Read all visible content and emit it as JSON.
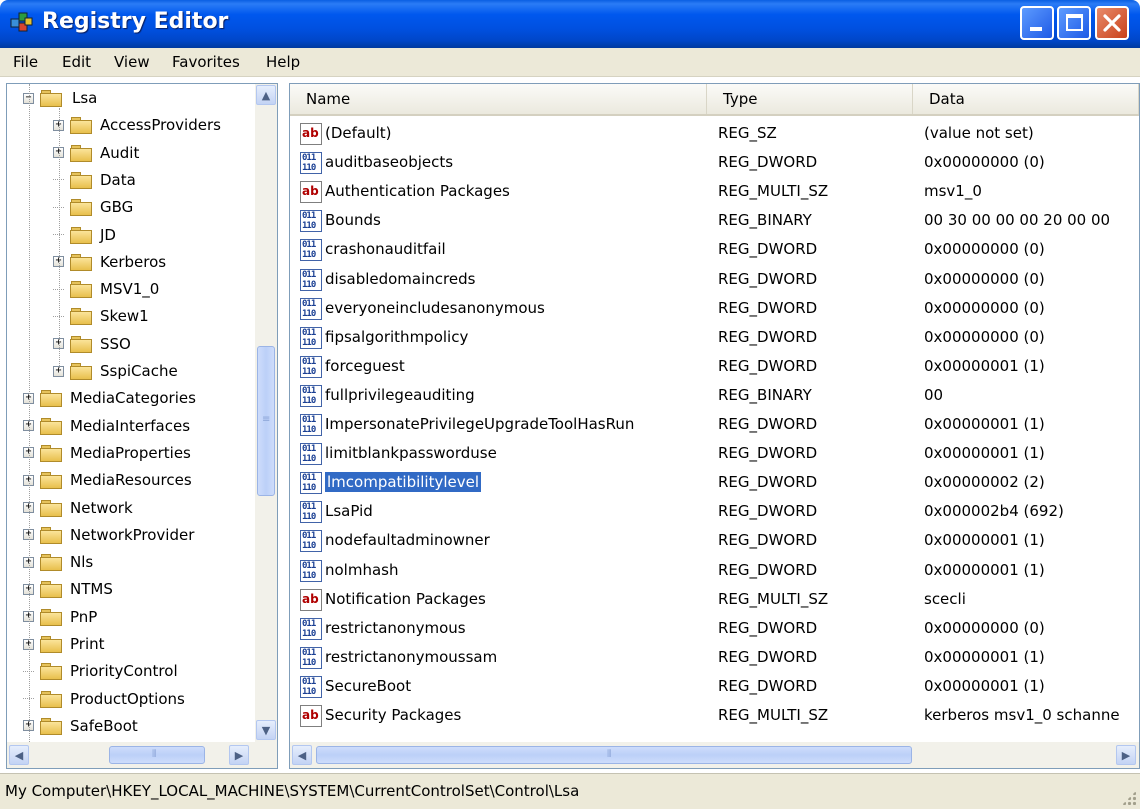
{
  "window": {
    "title": "Registry Editor",
    "buttons": {
      "minimize": "minimize",
      "maximize": "maximize",
      "close": "close"
    }
  },
  "menu": [
    "File",
    "Edit",
    "View",
    "Favorites",
    "Help"
  ],
  "tree": {
    "items": [
      {
        "label": "Lsa",
        "level": 1,
        "expander": "−",
        "open": true
      },
      {
        "label": "AccessProviders",
        "level": 2,
        "expander": "+"
      },
      {
        "label": "Audit",
        "level": 2,
        "expander": "+"
      },
      {
        "label": "Data",
        "level": 2,
        "expander": ""
      },
      {
        "label": "GBG",
        "level": 2,
        "expander": ""
      },
      {
        "label": "JD",
        "level": 2,
        "expander": ""
      },
      {
        "label": "Kerberos",
        "level": 2,
        "expander": "+"
      },
      {
        "label": "MSV1_0",
        "level": 2,
        "expander": ""
      },
      {
        "label": "Skew1",
        "level": 2,
        "expander": ""
      },
      {
        "label": "SSO",
        "level": 2,
        "expander": "+"
      },
      {
        "label": "SspiCache",
        "level": 2,
        "expander": "+"
      },
      {
        "label": "MediaCategories",
        "level": 1,
        "expander": "+"
      },
      {
        "label": "MediaInterfaces",
        "level": 1,
        "expander": "+"
      },
      {
        "label": "MediaProperties",
        "level": 1,
        "expander": "+"
      },
      {
        "label": "MediaResources",
        "level": 1,
        "expander": "+"
      },
      {
        "label": "Network",
        "level": 1,
        "expander": "+"
      },
      {
        "label": "NetworkProvider",
        "level": 1,
        "expander": "+"
      },
      {
        "label": "Nls",
        "level": 1,
        "expander": "+"
      },
      {
        "label": "NTMS",
        "level": 1,
        "expander": "+"
      },
      {
        "label": "PnP",
        "level": 1,
        "expander": "+"
      },
      {
        "label": "Print",
        "level": 1,
        "expander": "+"
      },
      {
        "label": "PriorityControl",
        "level": 1,
        "expander": ""
      },
      {
        "label": "ProductOptions",
        "level": 1,
        "expander": ""
      },
      {
        "label": "SafeBoot",
        "level": 1,
        "expander": "+"
      }
    ]
  },
  "list": {
    "columns": [
      "Name",
      "Type",
      "Data"
    ],
    "rows": [
      {
        "name": "(Default)",
        "type": "REG_SZ",
        "data": "(value not set)",
        "icon": "string-value-icon"
      },
      {
        "name": "auditbaseobjects",
        "type": "REG_DWORD",
        "data": "0x00000000 (0)",
        "icon": "binary-value-icon"
      },
      {
        "name": "Authentication Packages",
        "type": "REG_MULTI_SZ",
        "data": "msv1_0",
        "icon": "string-value-icon"
      },
      {
        "name": "Bounds",
        "type": "REG_BINARY",
        "data": "00 30 00 00 00 20 00 00",
        "icon": "binary-value-icon"
      },
      {
        "name": "crashonauditfail",
        "type": "REG_DWORD",
        "data": "0x00000000 (0)",
        "icon": "binary-value-icon"
      },
      {
        "name": "disabledomaincreds",
        "type": "REG_DWORD",
        "data": "0x00000000 (0)",
        "icon": "binary-value-icon"
      },
      {
        "name": "everyoneincludesanonymous",
        "type": "REG_DWORD",
        "data": "0x00000000 (0)",
        "icon": "binary-value-icon"
      },
      {
        "name": "fipsalgorithmpolicy",
        "type": "REG_DWORD",
        "data": "0x00000000 (0)",
        "icon": "binary-value-icon"
      },
      {
        "name": "forceguest",
        "type": "REG_DWORD",
        "data": "0x00000001 (1)",
        "icon": "binary-value-icon"
      },
      {
        "name": "fullprivilegeauditing",
        "type": "REG_BINARY",
        "data": "00",
        "icon": "binary-value-icon"
      },
      {
        "name": "ImpersonatePrivilegeUpgradeToolHasRun",
        "type": "REG_DWORD",
        "data": "0x00000001 (1)",
        "icon": "binary-value-icon"
      },
      {
        "name": "limitblankpassworduse",
        "type": "REG_DWORD",
        "data": "0x00000001 (1)",
        "icon": "binary-value-icon"
      },
      {
        "name": "lmcompatibilitylevel",
        "type": "REG_DWORD",
        "data": "0x00000002 (2)",
        "icon": "binary-value-icon",
        "selected": true
      },
      {
        "name": "LsaPid",
        "type": "REG_DWORD",
        "data": "0x000002b4 (692)",
        "icon": "binary-value-icon"
      },
      {
        "name": "nodefaultadminowner",
        "type": "REG_DWORD",
        "data": "0x00000001 (1)",
        "icon": "binary-value-icon"
      },
      {
        "name": "nolmhash",
        "type": "REG_DWORD",
        "data": "0x00000001 (1)",
        "icon": "binary-value-icon"
      },
      {
        "name": "Notification Packages",
        "type": "REG_MULTI_SZ",
        "data": "scecli",
        "icon": "string-value-icon"
      },
      {
        "name": "restrictanonymous",
        "type": "REG_DWORD",
        "data": "0x00000000 (0)",
        "icon": "binary-value-icon"
      },
      {
        "name": "restrictanonymoussam",
        "type": "REG_DWORD",
        "data": "0x00000001 (1)",
        "icon": "binary-value-icon"
      },
      {
        "name": "SecureBoot",
        "type": "REG_DWORD",
        "data": "0x00000001 (1)",
        "icon": "binary-value-icon"
      },
      {
        "name": "Security Packages",
        "type": "REG_MULTI_SZ",
        "data": "kerberos msv1_0 schanne",
        "icon": "string-value-icon"
      }
    ]
  },
  "status": {
    "path": "My Computer\\HKEY_LOCAL_MACHINE\\SYSTEM\\CurrentControlSet\\Control\\Lsa"
  },
  "icons": {
    "string_glyph": "ab",
    "binary_glyph": "011\n110"
  },
  "colors": {
    "titlebar": "#0054e3",
    "selection": "#316ac5",
    "chrome": "#ece9d8"
  }
}
